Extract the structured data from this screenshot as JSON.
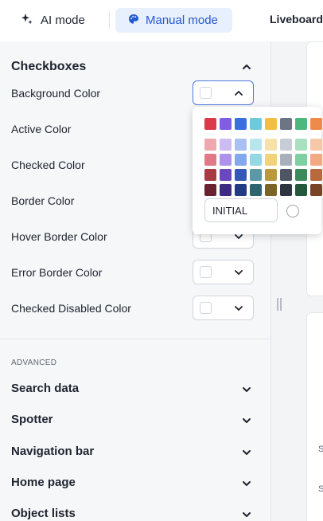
{
  "header": {
    "ai_mode_label": "AI mode",
    "manual_mode_label": "Manual mode",
    "liveboard_label": "Liveboard"
  },
  "panel": {
    "section_title": "Checkboxes",
    "rows": [
      {
        "label": "Background Color"
      },
      {
        "label": "Active Color"
      },
      {
        "label": "Checked Color"
      },
      {
        "label": "Border Color"
      },
      {
        "label": "Hover Border Color"
      },
      {
        "label": "Error Border Color"
      },
      {
        "label": "Checked Disabled Color"
      }
    ],
    "advanced_label": "ADVANCED",
    "groups": [
      {
        "label": "Search data"
      },
      {
        "label": "Spotter"
      },
      {
        "label": "Navigation bar"
      },
      {
        "label": "Home page"
      },
      {
        "label": "Object lists"
      }
    ]
  },
  "color_picker": {
    "hex_value": "INITIAL",
    "top_row": [
      "#dc3a4a",
      "#7f5de4",
      "#3a6fe0",
      "#6fc9dc",
      "#f0c040",
      "#6c7584",
      "#4cb87d",
      "#ee8a4a"
    ],
    "shades": [
      [
        "#f0a8b0",
        "#ccbcf2",
        "#a8c0f2",
        "#b8e6ee",
        "#f6e2a8",
        "#c8ccd4",
        "#a8e0c0",
        "#f6c8a8"
      ],
      [
        "#e07a86",
        "#ac92ea",
        "#84a8ee",
        "#94d8e4",
        "#f2d27c",
        "#a8b0bc",
        "#7ed0a0",
        "#f2aa80"
      ],
      [
        "#a83a44",
        "#6c48c0",
        "#3458b8",
        "#5a9aa8",
        "#b89a3c",
        "#4e5664",
        "#3c8a5c",
        "#b86a3c"
      ],
      [
        "#6a2230",
        "#3e2c84",
        "#223a84",
        "#2e6470",
        "#7a6428",
        "#2e3440",
        "#24583c",
        "#7a4426"
      ]
    ]
  },
  "right": {
    "text_a": "S",
    "text_b": "S"
  }
}
